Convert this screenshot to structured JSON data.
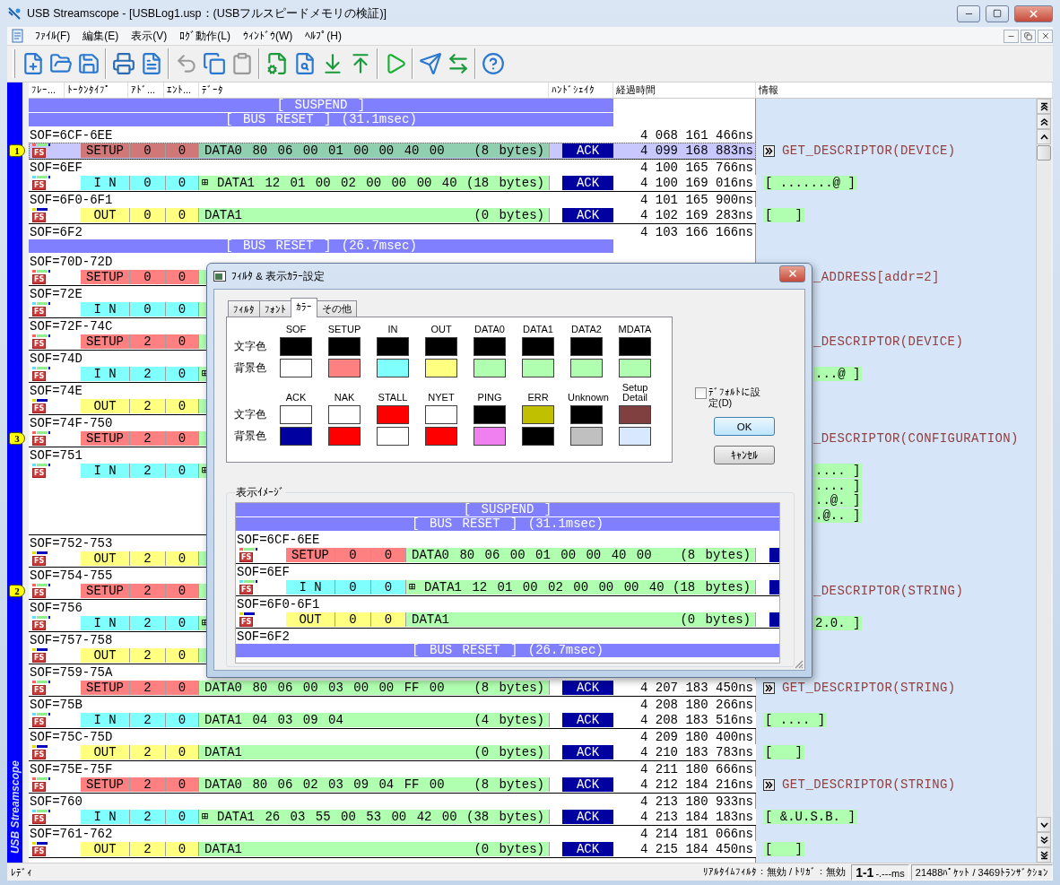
{
  "window": {
    "title": "USB Streamscope - [USBLog1.usp：(USBフルスピードメモリの検証)]"
  },
  "menu": [
    "ﾌｧｲﾙ(F)",
    "編集(E)",
    "表示(V)",
    "ﾛｸﾞ動作(L)",
    "ｳｨﾝﾄﾞｳ(W)",
    "ﾍﾙﾌﾟ(H)"
  ],
  "toolbar": {
    "groups": [
      {
        "buttons": [
          {
            "kind": "new",
            "disabled": false
          },
          {
            "kind": "open",
            "disabled": false
          },
          {
            "kind": "save",
            "disabled": false
          }
        ]
      },
      {
        "buttons": [
          {
            "kind": "print",
            "disabled": false
          },
          {
            "kind": "notes",
            "disabled": false
          }
        ]
      },
      {
        "buttons": [
          {
            "kind": "undo",
            "disabled": true
          },
          {
            "kind": "copy",
            "disabled": false
          },
          {
            "kind": "paste",
            "disabled": true
          }
        ]
      },
      {
        "buttons": [
          {
            "kind": "settings",
            "disabled": false
          },
          {
            "kind": "search",
            "disabled": false
          },
          {
            "kind": "search-next",
            "disabled": false
          },
          {
            "kind": "search-prev",
            "disabled": false
          }
        ]
      },
      {
        "buttons": [
          {
            "kind": "play",
            "disabled": false
          }
        ]
      },
      {
        "buttons": [
          {
            "kind": "send",
            "disabled": false
          },
          {
            "kind": "swap",
            "disabled": false
          }
        ]
      },
      {
        "buttons": [
          {
            "kind": "help",
            "disabled": false
          }
        ]
      }
    ]
  },
  "side_banner": "USB Streamscope",
  "columns": [
    "ﾌﾚｰ...",
    "ﾄｰｸﾝﾀｲﾌﾟ",
    "ｱﾄﾞ...",
    "ｴﾝﾄ...",
    "ﾃﾞｰﾀ",
    "ﾊﾝﾄﾞｼｪｲｸ",
    "経過時間",
    "情報"
  ],
  "log": {
    "entries": [
      {
        "kind": "banner",
        "text": "[ SUSPEND ]"
      },
      {
        "kind": "banner",
        "text": "[ BUS RESET ] (31.1msec)"
      },
      {
        "kind": "transaction",
        "sof": "SOF=6CF-6EE",
        "sof_time": "4 068 161 466ns",
        "marker": "1",
        "selected": true,
        "speed": "FS",
        "token": {
          "kind": "setup",
          "text": "SETUP"
        },
        "addr": "0",
        "endp": "0",
        "data": "DATA0 80 06 00 01 00 00 40 00",
        "size": "(8 bytes)",
        "handshake": "ACK",
        "time": "4 099 168 883ns",
        "info": [
          {
            "kind": "detail",
            "text": "GET_DESCRIPTOR(DEVICE)",
            "cut": false
          }
        ]
      },
      {
        "kind": "transaction",
        "sof": "SOF=6EF",
        "sof_time": "4 100 165 766ns",
        "selected": false,
        "speed": "FS",
        "token": {
          "kind": "in",
          "text": "I N"
        },
        "addr": "0",
        "endp": "0",
        "expander": "⊞",
        "data": "DATA1 12 01 00 02 00 00 00 40",
        "size": "(18 bytes)",
        "handshake": "ACK",
        "time": "4 100 169 016ns",
        "info": [
          {
            "kind": "data",
            "text": "[ .......@ ]",
            "cut": false
          }
        ]
      },
      {
        "kind": "transaction",
        "sof": "SOF=6F0-6F1",
        "sof_time": "4 101 165 900ns",
        "selected": false,
        "speed": "FS",
        "token": {
          "kind": "out",
          "text": "OUT"
        },
        "addr": "0",
        "endp": "0",
        "data": "DATA1",
        "size": "(0 bytes)",
        "handshake": "ACK",
        "time": "4 102 169 283ns",
        "info": [
          {
            "kind": "data",
            "text": "[   ]",
            "cut": false
          }
        ]
      },
      {
        "kind": "sof",
        "label": "SOF=6F2",
        "time": "4 103 166 166ns"
      },
      {
        "kind": "banner",
        "text": "[ BUS RESET ] (26.7msec)"
      },
      {
        "kind": "transaction",
        "sof": "SOF=70D-72D",
        "selected": false,
        "speed": "FS",
        "token": {
          "kind": "setup",
          "text": "SETUP"
        },
        "addr": "0",
        "endp": "0",
        "info": [
          {
            "kind": "detail",
            "text": "_ADDRESS[addr=2]",
            "cut": true
          }
        ]
      },
      {
        "kind": "transaction",
        "sof": "SOF=72E",
        "selected": false,
        "speed": "FS",
        "token": {
          "kind": "in",
          "text": "I N"
        },
        "addr": "0",
        "endp": "0"
      },
      {
        "kind": "transaction",
        "sof": "SOF=72F-74C",
        "selected": false,
        "speed": "FS",
        "token": {
          "kind": "setup",
          "text": "SETUP"
        },
        "addr": "2",
        "endp": "0",
        "info": [
          {
            "kind": "detail",
            "text": "_DESCRIPTOR(DEVICE)",
            "cut": true
          }
        ]
      },
      {
        "kind": "transaction",
        "sof": "SOF=74D",
        "selected": false,
        "speed": "FS",
        "token": {
          "kind": "in",
          "text": "I N"
        },
        "addr": "2",
        "endp": "0",
        "expander": "⊞",
        "info": [
          {
            "kind": "data",
            "text": "...@ ]",
            "cut": true
          }
        ]
      },
      {
        "kind": "transaction",
        "sof": "SOF=74E",
        "selected": false,
        "speed": "FS",
        "token": {
          "kind": "out",
          "text": "OUT"
        },
        "addr": "2",
        "endp": "0"
      },
      {
        "kind": "transaction",
        "sof": "SOF=74F-750",
        "marker": "3",
        "selected": false,
        "speed": "FS",
        "token": {
          "kind": "setup",
          "text": "SETUP"
        },
        "addr": "2",
        "endp": "0",
        "info": [
          {
            "kind": "detail",
            "text": "_DESCRIPTOR(CONFIGURATION)",
            "cut": true
          }
        ]
      },
      {
        "kind": "transaction",
        "sof": "SOF=751",
        "selected": false,
        "speed": "FS",
        "token": {
          "kind": "in",
          "text": "I N"
        },
        "addr": "2",
        "endp": "0",
        "expander": "⊞",
        "info": [
          {
            "kind": "data",
            "text": ".... ]",
            "cut": true
          },
          {
            "kind": "data",
            "text": ".... ]",
            "cut": true
          },
          {
            "kind": "data",
            "text": "..@. ]",
            "cut": true
          },
          {
            "kind": "data",
            "text": ".@.. ]",
            "cut": true
          }
        ]
      },
      {
        "kind": "transaction",
        "sof": "SOF=752-753",
        "selected": false,
        "speed": "FS",
        "token": {
          "kind": "out",
          "text": "OUT"
        },
        "addr": "2",
        "endp": "0"
      },
      {
        "kind": "transaction",
        "sof": "SOF=754-755",
        "marker": "2",
        "selected": false,
        "speed": "FS",
        "token": {
          "kind": "setup",
          "text": "SETUP"
        },
        "addr": "2",
        "endp": "0",
        "info": [
          {
            "kind": "detail",
            "text": "_DESCRIPTOR(STRING)",
            "cut": true
          }
        ]
      },
      {
        "kind": "transaction",
        "sof": "SOF=756",
        "selected": false,
        "speed": "FS",
        "token": {
          "kind": "in",
          "text": "I N"
        },
        "addr": "2",
        "endp": "0",
        "expander": "⊞",
        "info": [
          {
            "kind": "data",
            "text": "2.0. ]",
            "cut": true
          }
        ]
      },
      {
        "kind": "transaction",
        "sof": "SOF=757-758",
        "selected": false,
        "speed": "FS",
        "token": {
          "kind": "out",
          "text": "OUT"
        },
        "addr": "2",
        "endp": "0"
      },
      {
        "kind": "transaction",
        "sof": "SOF=759-75A",
        "selected": false,
        "speed": "FS",
        "token": {
          "kind": "setup",
          "text": "SETUP"
        },
        "addr": "2",
        "endp": "0",
        "data": "DATA0 80 06 00 03 00 00 FF 00",
        "size": "(8 bytes)",
        "handshake": "ACK",
        "time": "4 207 183 450ns",
        "info": [
          {
            "kind": "detail",
            "text": "GET_DESCRIPTOR(STRING)",
            "cut": false
          }
        ]
      },
      {
        "kind": "transaction",
        "sof": "SOF=75B",
        "sof_time": "4 208 180 266ns",
        "selected": false,
        "speed": "FS",
        "token": {
          "kind": "in",
          "text": "I N"
        },
        "addr": "2",
        "endp": "0",
        "data": "DATA1 04 03 09 04",
        "size": "(4 bytes)",
        "handshake": "ACK",
        "time": "4 208 183 516ns",
        "info": [
          {
            "kind": "data",
            "text": "[ .... ]",
            "cut": false
          }
        ]
      },
      {
        "kind": "transaction",
        "sof": "SOF=75C-75D",
        "sof_time": "4 209 180 400ns",
        "selected": false,
        "speed": "FS",
        "token": {
          "kind": "out",
          "text": "OUT"
        },
        "addr": "2",
        "endp": "0",
        "data": "DATA1",
        "size": "(0 bytes)",
        "handshake": "ACK",
        "time": "4 210 183 783ns",
        "info": [
          {
            "kind": "data",
            "text": "[   ]",
            "cut": false
          }
        ]
      },
      {
        "kind": "transaction",
        "sof": "SOF=75E-75F",
        "sof_time": "4 211 180 666ns",
        "selected": false,
        "speed": "FS",
        "token": {
          "kind": "setup",
          "text": "SETUP"
        },
        "addr": "2",
        "endp": "0",
        "data": "DATA0 80 06 02 03 09 04 FF 00",
        "size": "(8 bytes)",
        "handshake": "ACK",
        "time": "4 212 184 216ns",
        "info": [
          {
            "kind": "detail",
            "text": "GET_DESCRIPTOR(STRING)",
            "cut": false
          }
        ]
      },
      {
        "kind": "transaction",
        "sof": "SOF=760",
        "sof_time": "4 213 180 933ns",
        "selected": false,
        "speed": "FS",
        "token": {
          "kind": "in",
          "text": "I N"
        },
        "addr": "2",
        "endp": "0",
        "expander": "⊞",
        "data": "DATA1 26 03 55 00 53 00 42 00",
        "size": "(38 bytes)",
        "handshake": "ACK",
        "time": "4 213 184 183ns",
        "info": [
          {
            "kind": "data",
            "text": "[ &.U.S.B. ]",
            "cut": false
          }
        ]
      },
      {
        "kind": "transaction",
        "sof": "SOF=761-762",
        "sof_time": "4 214 181 066ns",
        "selected": false,
        "speed": "FS",
        "token": {
          "kind": "out",
          "text": "OUT"
        },
        "addr": "2",
        "endp": "0",
        "data": "DATA1",
        "size": "(0 bytes)",
        "handshake": "ACK",
        "time": "4 215 184 450ns",
        "info": [
          {
            "kind": "data",
            "text": "[   ]",
            "cut": false
          }
        ]
      }
    ]
  },
  "dialog": {
    "title": "ﾌｨﾙﾀ & 表示ｶﾗｰ設定",
    "tabs": [
      {
        "label": "ﾌｨﾙﾀ",
        "selected": false
      },
      {
        "label": "ﾌｫﾝﾄ",
        "selected": false
      },
      {
        "label": "ｶﾗｰ",
        "selected": true
      },
      {
        "label": "その他",
        "selected": false
      }
    ],
    "color_groups": [
      {
        "row_labels": [
          "文字色",
          "背景色"
        ],
        "items": [
          {
            "label": "SOF",
            "swatches": [
              {
                "color": "#000000"
              },
              {
                "color": "#ffffff"
              }
            ]
          },
          {
            "label": "SETUP",
            "swatches": [
              {
                "color": "#000000"
              },
              {
                "color": "#ff8080"
              }
            ]
          },
          {
            "label": "IN",
            "swatches": [
              {
                "color": "#000000"
              },
              {
                "color": "#80ffff"
              }
            ]
          },
          {
            "label": "OUT",
            "swatches": [
              {
                "color": "#000000"
              },
              {
                "color": "#ffff80"
              }
            ]
          },
          {
            "label": "DATA0",
            "swatches": [
              {
                "color": "#000000"
              },
              {
                "color": "#b0ffb0"
              }
            ]
          },
          {
            "label": "DATA1",
            "swatches": [
              {
                "color": "#000000"
              },
              {
                "color": "#b0ffb0"
              }
            ]
          },
          {
            "label": "DATA2",
            "swatches": [
              {
                "color": "#000000"
              },
              {
                "color": "#b0ffb0"
              }
            ]
          },
          {
            "label": "MDATA",
            "swatches": [
              {
                "color": "#000000"
              },
              {
                "color": "#b0ffb0"
              }
            ]
          }
        ]
      },
      {
        "row_labels": [
          "文字色",
          "背景色"
        ],
        "items": [
          {
            "label": "ACK",
            "swatches": [
              {
                "color": "#ffffff"
              },
              {
                "color": "#0000a0"
              }
            ]
          },
          {
            "label": "NAK",
            "swatches": [
              {
                "color": "#ffffff"
              },
              {
                "color": "#ff0000"
              }
            ]
          },
          {
            "label": "STALL",
            "swatches": [
              {
                "color": "#ff0000"
              },
              {
                "color": "#ffffff"
              }
            ]
          },
          {
            "label": "NYET",
            "swatches": [
              {
                "color": "#ffffff"
              },
              {
                "color": "#ff0000"
              }
            ]
          },
          {
            "label": "PING",
            "swatches": [
              {
                "color": "#000000"
              },
              {
                "color": "#f080f0"
              }
            ]
          },
          {
            "label": "ERR",
            "swatches": [
              {
                "color": "#c0c000"
              },
              {
                "color": "#000000"
              }
            ]
          },
          {
            "label": "Unknown",
            "swatches": [
              {
                "color": "#000000"
              },
              {
                "color": "#c0c0c0"
              }
            ]
          },
          {
            "label": "Setup Detail",
            "swatches": [
              {
                "color": "#804040"
              },
              {
                "color": "#d8e8ff"
              }
            ]
          }
        ]
      }
    ],
    "default_checkbox": {
      "label": "ﾃﾞﾌｫﾙﾄに設定(D)",
      "checked": false
    },
    "buttons": [
      "OK",
      "ｷｬﾝｾﾙ"
    ],
    "preview": {
      "title": "表示ｲﾒｰｼﾞ",
      "entries": [
        {
          "kind": "banner",
          "text": "[ SUSPEND ]"
        },
        {
          "kind": "banner",
          "text": "[ BUS RESET ] (31.1msec)"
        },
        {
          "kind": "transaction",
          "sof": "SOF=6CF-6EE",
          "speed": "FS",
          "token": {
            "kind": "setup",
            "text": "SETUP"
          },
          "addr": "0",
          "endp": "0",
          "data": "DATA0 80 06 00 01 00 00 40 00",
          "size": "(8 bytes)"
        },
        {
          "kind": "transaction",
          "sof": "SOF=6EF",
          "speed": "FS",
          "token": {
            "kind": "in",
            "text": "I N"
          },
          "addr": "0",
          "endp": "0",
          "expander": "⊞",
          "data": "DATA1 12 01 00 02 00 00 00 40",
          "size": "(18 bytes)"
        },
        {
          "kind": "transaction",
          "sof": "SOF=6F0-6F1",
          "speed": "FS",
          "token": {
            "kind": "out",
            "text": "OUT"
          },
          "addr": "0",
          "endp": "0",
          "data": "DATA1",
          "size": "(0 bytes)"
        },
        {
          "kind": "sof",
          "label": "SOF=6F2"
        },
        {
          "kind": "banner",
          "text": "[ BUS RESET ] (26.7msec)"
        }
      ]
    }
  },
  "status_bar": {
    "message": "ﾚﾃﾞｨ",
    "filter": "ﾘｱﾙﾀｲﾑﾌｨﾙﾀ：無効 / ﾄﾘｶﾞ：無効",
    "range": "1-1",
    "duration": "-.---ms",
    "counts": "21488ﾊﾟｹｯﾄ / 3469ﾄﾗﾝｻﾞｸｼｮﾝ"
  }
}
